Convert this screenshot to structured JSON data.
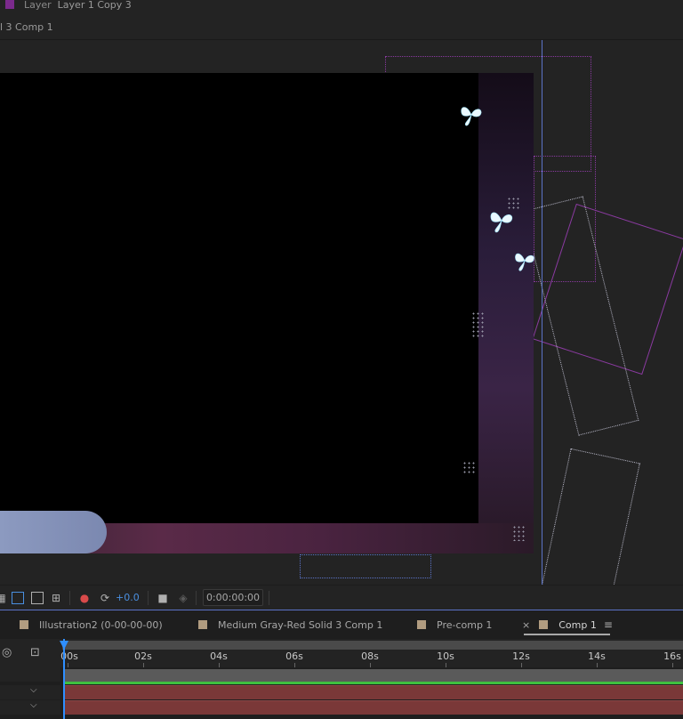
{
  "viewer_header": {
    "layer_label": "Layer",
    "layer_name": "Layer 1 Copy 3",
    "comp_crumb": "l 3 Comp 1"
  },
  "toolbar": {
    "exposure_value": "+0.0",
    "timecode": "0:00:00:00"
  },
  "timeline_tabs": [
    {
      "label": "Illustration2 (0-00-00-00)"
    },
    {
      "label": "Medium Gray-Red Solid 3 Comp 1"
    },
    {
      "label": "Pre-comp 1"
    },
    {
      "label": "Comp 1"
    }
  ],
  "active_tab_close": "×",
  "active_tab_menu": "≡",
  "ruler": {
    "ticks": [
      "00s",
      "02s",
      "04s",
      "06s",
      "08s",
      "10s",
      "12s",
      "14s",
      "16s"
    ]
  },
  "colors": {
    "label_purple": "#7b2a8c",
    "tab_swatch": "#b19c80",
    "cti_blue": "#2f8fff",
    "track_red": "#7a3838",
    "track_green": "#3fbf3f"
  }
}
